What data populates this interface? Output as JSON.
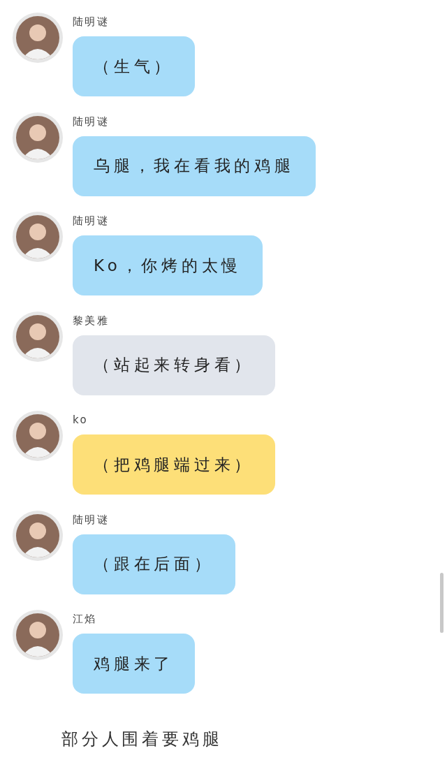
{
  "messages": [
    {
      "sender": "陆明谜",
      "text": "（生气）",
      "color": "#a6dcf9"
    },
    {
      "sender": "陆明谜",
      "text": "乌腿，我在看我的鸡腿",
      "color": "#a6dcf9"
    },
    {
      "sender": "陆明谜",
      "text": "Ko，你烤的太慢",
      "color": "#a6dcf9"
    },
    {
      "sender": "黎美雅",
      "text": "（站起来转身看）",
      "color": "#e1e5ec"
    },
    {
      "sender": "ko",
      "text": "（把鸡腿端过来）",
      "color": "#fddf78"
    },
    {
      "sender": "陆明谜",
      "text": "（跟在后面）",
      "color": "#a6dcf9"
    },
    {
      "sender": "江焰",
      "text": "鸡腿来了",
      "color": "#a6dcf9"
    }
  ],
  "caption": "部分人围着要鸡腿"
}
